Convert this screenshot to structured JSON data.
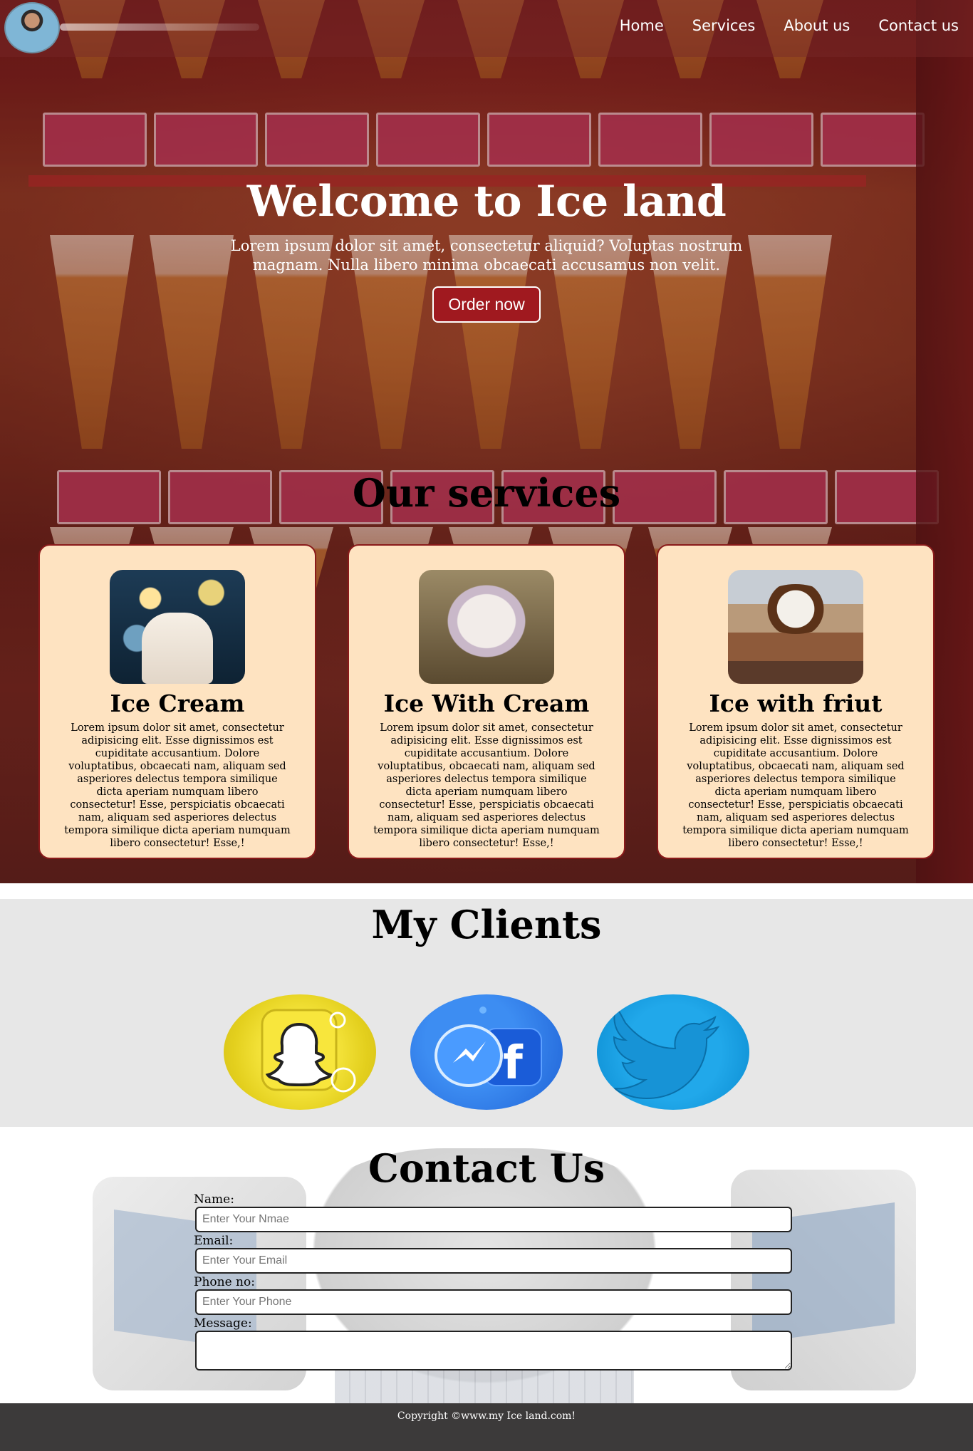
{
  "nav": {
    "links": [
      "Home",
      "Services",
      "About us",
      "Contact us"
    ]
  },
  "hero": {
    "title": "Welcome to Ice land",
    "text": "Lorem ipsum dolor sit amet, consectetur aliquid? Voluptas nostrum magnam. Nulla libero minima obcaecati accusamus non velit.",
    "button": "Order now"
  },
  "services": {
    "title": "Our services",
    "cards": [
      {
        "title": "Ice Cream",
        "text": "Lorem ipsum dolor sit amet, consectetur adipisicing elit. Esse dignissimos est cupiditate accusantium. Dolore voluptatibus, obcaecati nam, aliquam sed asperiores delectus tempora similique dicta aperiam numquam libero consectetur! Esse, perspiciatis obcaecati nam, aliquam sed asperiores delectus tempora similique dicta aperiam numquam libero consectetur! Esse,!"
      },
      {
        "title": "Ice With Cream",
        "text": "Lorem ipsum dolor sit amet, consectetur adipisicing elit. Esse dignissimos est cupiditate accusantium. Dolore voluptatibus, obcaecati nam, aliquam sed asperiores delectus tempora similique dicta aperiam numquam libero consectetur! Esse, perspiciatis obcaecati nam, aliquam sed asperiores delectus tempora similique dicta aperiam numquam libero consectetur! Esse,!"
      },
      {
        "title": "Ice with friut",
        "text": "Lorem ipsum dolor sit amet, consectetur adipisicing elit. Esse dignissimos est cupiditate accusantium. Dolore voluptatibus, obcaecati nam, aliquam sed asperiores delectus tempora similique dicta aperiam numquam libero consectetur! Esse, perspiciatis obcaecati nam, aliquam sed asperiores delectus tempora similique dicta aperiam numquam libero consectetur! Esse,!"
      }
    ]
  },
  "clients": {
    "title": "My Clients",
    "logos": [
      "snapchat-icon",
      "messenger-facebook-icon",
      "twitter-icon"
    ]
  },
  "contact": {
    "title": "Contact Us",
    "name_label": "Name:",
    "name_placeholder": "Enter Your Nmae",
    "email_label": "Email:",
    "email_placeholder": "Enter Your Email",
    "phone_label": "Phone no:",
    "phone_placeholder": "Enter Your Phone",
    "message_label": "Message:"
  },
  "footer": {
    "text": "Copyright ©www.my Ice land.com!"
  },
  "colors": {
    "button_bg": "#a0191f",
    "card_bg": "#fee3c1",
    "card_border": "#8a1a1a",
    "clients_bg": "#e7e7e7",
    "footer_bg": "#3c3a3a"
  }
}
